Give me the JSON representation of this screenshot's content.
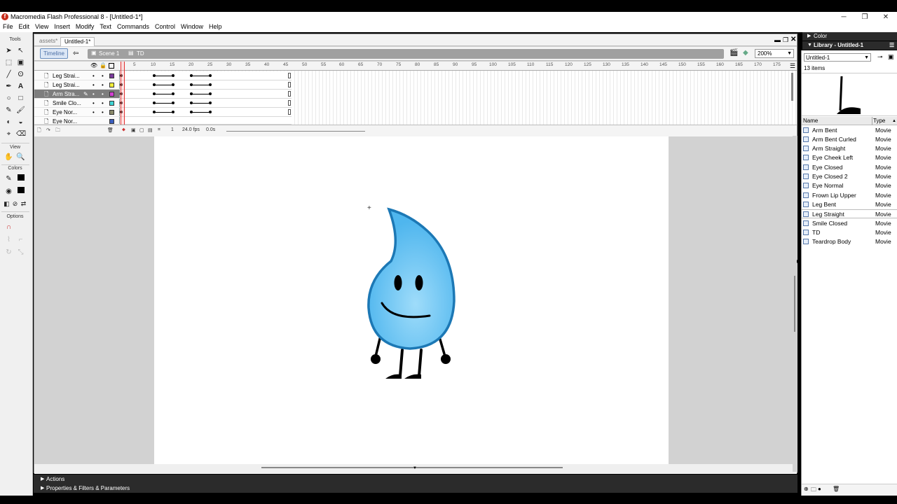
{
  "window": {
    "title": "Macromedia Flash Professional 8 - [Untitled-1*]",
    "minimize": "─",
    "maximize": "❐",
    "close": "✕"
  },
  "menu": [
    "File",
    "Edit",
    "View",
    "Insert",
    "Modify",
    "Text",
    "Commands",
    "Control",
    "Window",
    "Help"
  ],
  "tools_panel": {
    "header": "Tools",
    "view_header": "View",
    "colors_header": "Colors",
    "options_header": "Options"
  },
  "doc_tabs": [
    "assets*",
    "Untitled-1*"
  ],
  "edit_bar": {
    "timeline_label": "Timeline",
    "scene_label": "Scene 1",
    "symbol_label": "TD",
    "zoom": "200%"
  },
  "timeline": {
    "ruler_ticks": [
      "5",
      "10",
      "15",
      "20",
      "25",
      "30",
      "35",
      "40",
      "45",
      "50",
      "55",
      "60",
      "65",
      "70",
      "75",
      "80",
      "85",
      "90",
      "95",
      "100",
      "105",
      "110",
      "115",
      "120",
      "125",
      "130",
      "135",
      "140",
      "145",
      "150",
      "155",
      "160",
      "165",
      "170",
      "175"
    ],
    "layers": [
      {
        "name": "Leg Strai...",
        "color": "#7a3c9c"
      },
      {
        "name": "Leg Strai...",
        "color": "#f2ee3a"
      },
      {
        "name": "Arm Stra...",
        "color": "#d23fd2"
      },
      {
        "name": "Smile Clo...",
        "color": "#3fd6d6"
      },
      {
        "name": "Eye Nor...",
        "color": "#8a8a6a"
      },
      {
        "name": "Eye Nor...",
        "color": "#3b5fbf"
      }
    ],
    "current_frame": "1",
    "fps": "24.0 fps",
    "time": "0.0s"
  },
  "bottom_panels": {
    "actions": "Actions",
    "properties": "Properties & Filters & Parameters"
  },
  "right_panels": {
    "color_header": "Color",
    "library_header": "Library - Untitled-1",
    "library_selector": "Untitled-1",
    "item_count": "13 items",
    "col_name": "Name",
    "col_type": "Type"
  },
  "library_items": [
    {
      "name": "Arm Bent",
      "type": "Movie"
    },
    {
      "name": "Arm Bent Curled",
      "type": "Movie"
    },
    {
      "name": "Arm Straight",
      "type": "Movie"
    },
    {
      "name": "Eye Cheek Left",
      "type": "Movie"
    },
    {
      "name": "Eye Closed",
      "type": "Movie"
    },
    {
      "name": "Eye Closed 2",
      "type": "Movie"
    },
    {
      "name": "Eye Normal",
      "type": "Movie"
    },
    {
      "name": "Frown Lip Upper",
      "type": "Movie"
    },
    {
      "name": "Leg Bent",
      "type": "Movie"
    },
    {
      "name": "Leg Straight",
      "type": "Movie"
    },
    {
      "name": "Smile Closed",
      "type": "Movie"
    },
    {
      "name": "TD",
      "type": "Movie"
    },
    {
      "name": "Teardrop Body",
      "type": "Movie"
    }
  ],
  "colors": {
    "drop_fill": "#6cc4f2",
    "drop_stroke": "#1c78b5",
    "panel_dark": "#2b2b2b"
  }
}
